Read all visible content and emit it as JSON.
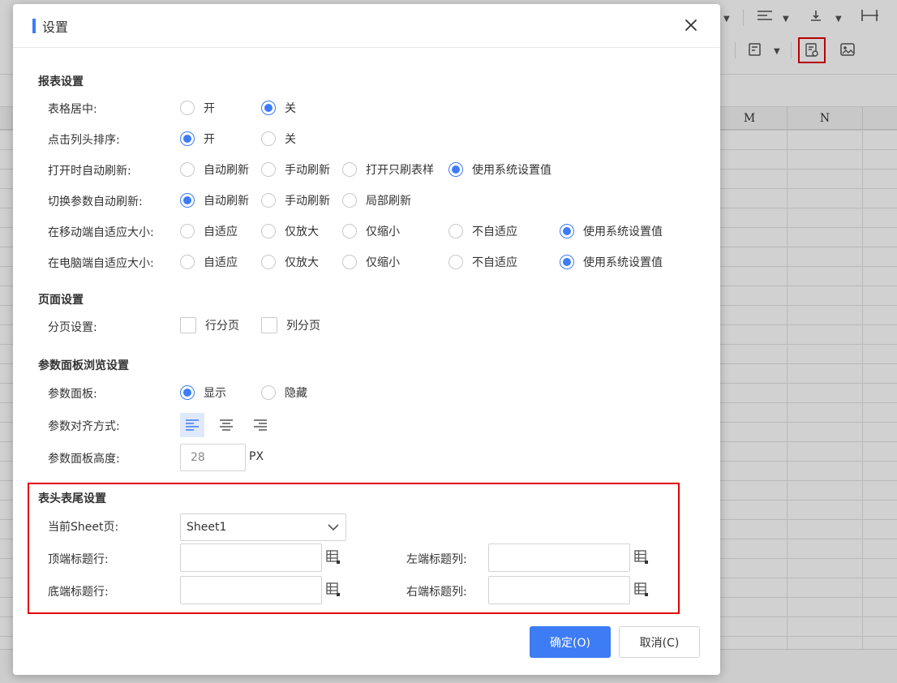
{
  "sheet": {
    "columns": [
      "M",
      "N"
    ],
    "markers": {
      "settings": "①",
      "header_footer": "②"
    }
  },
  "dialog": {
    "title": "设置",
    "colors": {
      "accent": "#3d7cf4",
      "highlight": "#e00000"
    },
    "report_settings": {
      "title": "报表设置",
      "rows": [
        {
          "label": "表格居中:",
          "options": [
            "开",
            "关"
          ],
          "selected": 1
        },
        {
          "label": "点击列头排序:",
          "options": [
            "开",
            "关"
          ],
          "selected": 0
        },
        {
          "label": "打开时自动刷新:",
          "options": [
            "自动刷新",
            "手动刷新",
            "打开只刷表样",
            "使用系统设置值"
          ],
          "selected": 3
        },
        {
          "label": "切换参数自动刷新:",
          "options": [
            "自动刷新",
            "手动刷新",
            "局部刷新"
          ],
          "selected": 0
        },
        {
          "label": "在移动端自适应大小:",
          "options": [
            "自适应",
            "仅放大",
            "仅缩小",
            "不自适应",
            "使用系统设置值"
          ],
          "selected": 4
        },
        {
          "label": "在电脑端自适应大小:",
          "options": [
            "自适应",
            "仅放大",
            "仅缩小",
            "不自适应",
            "使用系统设置值"
          ],
          "selected": 4
        }
      ]
    },
    "page_settings": {
      "title": "页面设置",
      "paging_label": "分页设置:",
      "row_paging": {
        "label": "行分页",
        "checked": false
      },
      "col_paging": {
        "label": "列分页",
        "checked": false
      }
    },
    "param_panel": {
      "title": "参数面板浏览设置",
      "panel_label": "参数面板:",
      "panel_options": [
        "显示",
        "隐藏"
      ],
      "panel_selected": 0,
      "align_label": "参数对齐方式:",
      "align_icons": [
        "align-left-icon",
        "align-center-icon",
        "align-right-icon"
      ],
      "align_selected": 0,
      "height_label": "参数面板高度:",
      "height_value": "28",
      "height_unit": "PX"
    },
    "header_footer": {
      "title": "表头表尾设置",
      "sheet_label": "当前Sheet页:",
      "sheet_value": "Sheet1",
      "top_title_row_label": "顶端标题行:",
      "top_title_row_value": "",
      "left_title_col_label": "左端标题列:",
      "left_title_col_value": "",
      "bottom_title_row_label": "底端标题行:",
      "bottom_title_row_value": "",
      "right_title_col_label": "右端标题列:",
      "right_title_col_value": ""
    },
    "buttons": {
      "ok": "确定(O)",
      "cancel": "取消(C)"
    }
  }
}
